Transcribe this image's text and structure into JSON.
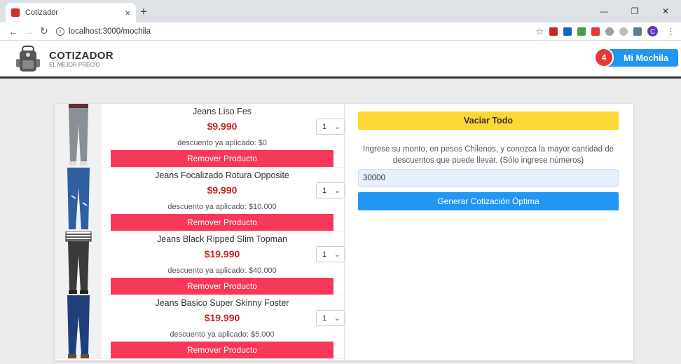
{
  "browser": {
    "tab_title": "Cotizador",
    "tab_close": "×",
    "new_tab": "+",
    "url": "localhost:3000/mochila",
    "profile_initial": "C"
  },
  "header": {
    "brand": "COTIZADOR",
    "tagline": "EL MEJOR PRECIO",
    "cart_label": "Mi Mochila",
    "cart_count": "4"
  },
  "products": [
    {
      "name": "Jeans Liso Fes",
      "price": "$9.990",
      "discount": "descuento ya aplicado: $0",
      "qty": "1",
      "remove": "Remover Producto"
    },
    {
      "name": "Jeans Focalizado Rotura Opposite",
      "price": "$9.990",
      "discount": "descuento ya aplicado: $10.000",
      "qty": "1",
      "remove": "Remover Producto"
    },
    {
      "name": "Jeans Black Ripped Slim Topman",
      "price": "$19.990",
      "discount": "descuento ya aplicado: $40.000",
      "qty": "1",
      "remove": "Remover Producto"
    },
    {
      "name": "Jeans Basico Super Skinny Foster",
      "price": "$19.990",
      "discount": "descuento ya aplicado: $5.000",
      "qty": "1",
      "remove": "Remover Producto"
    }
  ],
  "sidebar": {
    "clear_label": "Vaciar Todo",
    "help_text": "Ingrese su monto, en pesos Chilenos, y conozca la mayor cantidad de descuentos que puede llevar. (Sólo ingrese números)",
    "amount_value": "30000",
    "generate_label": "Generar Cotización Óptima"
  },
  "colors": {
    "accent_blue": "#2196f3",
    "remove_red": "#f73859",
    "price_red": "#c62828",
    "clear_yellow": "#fdd835"
  }
}
